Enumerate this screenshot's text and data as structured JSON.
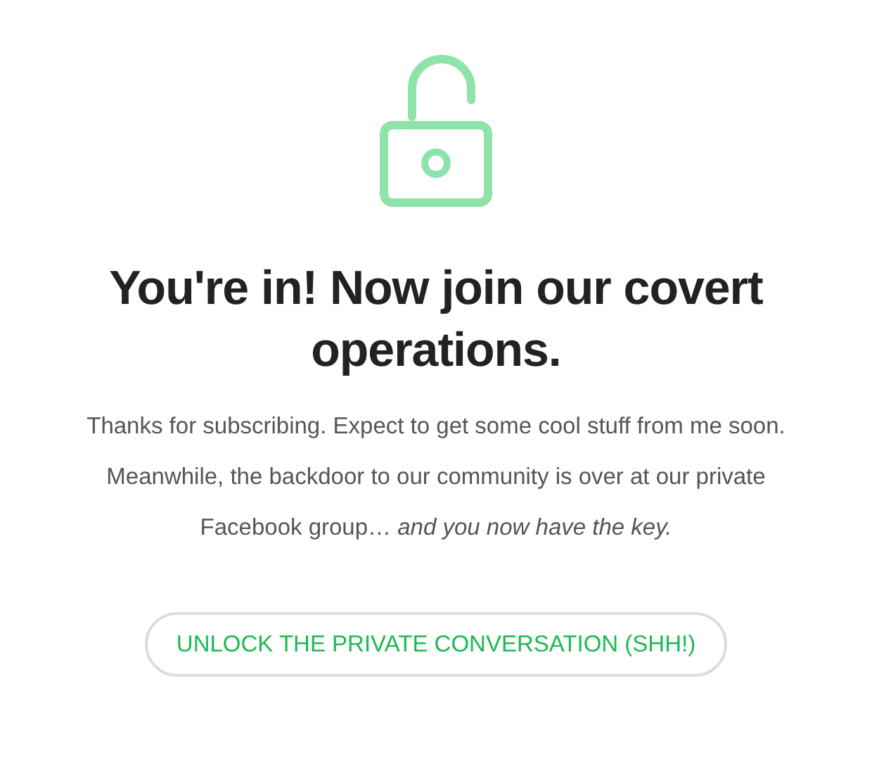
{
  "heading": "You're in! Now join our covert operations.",
  "message": "Thanks for subscribing. Expect to get some cool stuff from me soon. Meanwhile, the backdoor to our community is over at our private Facebook group… *and you now have the key.*",
  "button": {
    "label": "UNLOCK THE PRIVATE CONVERSATION (SHH!)"
  }
}
